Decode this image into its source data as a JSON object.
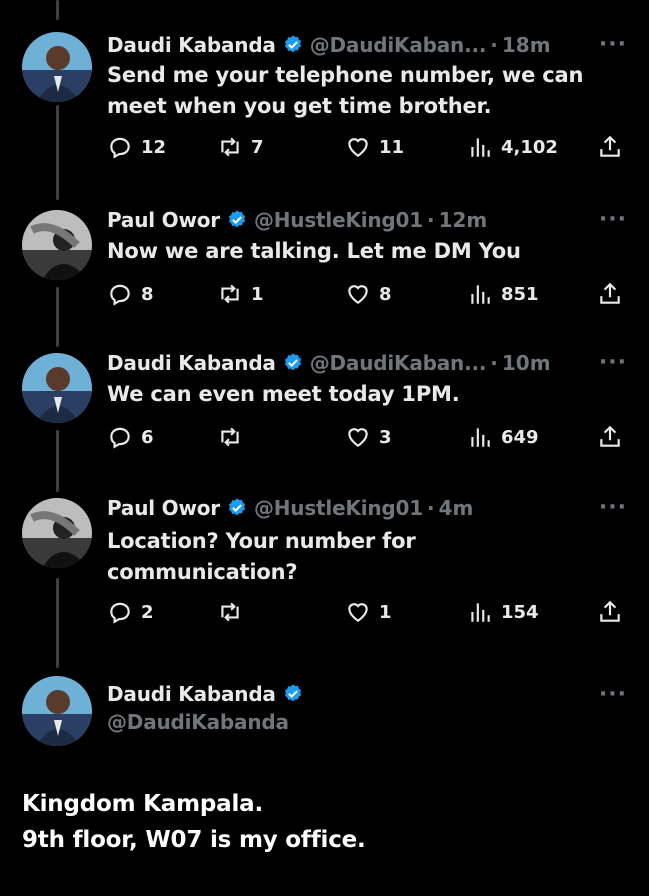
{
  "tweets": [
    {
      "name": "Daudi Kabanda",
      "handle": "@DaudiKaban...",
      "sep": "·",
      "time": "18m",
      "text": "Send me your telephone number, we can meet when you get time brother.",
      "replies": "12",
      "reposts": "7",
      "likes": "11",
      "views": "4,102"
    },
    {
      "name": "Paul Owor",
      "handle": "@HustleKing01",
      "sep": "·",
      "time": "12m",
      "text": "Now we are talking. Let me DM You",
      "replies": "8",
      "reposts": "1",
      "likes": "8",
      "views": "851"
    },
    {
      "name": "Daudi Kabanda",
      "handle": "@DaudiKaban...",
      "sep": "·",
      "time": "10m",
      "text": "We can even meet today 1PM.",
      "replies": "6",
      "reposts": "",
      "likes": "3",
      "views": "649"
    },
    {
      "name": "Paul Owor",
      "handle": "@HustleKing01",
      "sep": "·",
      "time": "4m",
      "text": "Location? Your number for communication?",
      "replies": "2",
      "reposts": "",
      "likes": "1",
      "views": "154"
    }
  ],
  "main_tweet": {
    "name": "Daudi Kabanda",
    "handle": "@DaudiKabanda",
    "line1": "Kingdom Kampala.",
    "line2": "9th floor, W07 is my office."
  },
  "icons": {
    "more": "more-icon",
    "reply": "reply-icon",
    "repost": "repost-icon",
    "like": "heart-icon",
    "views": "views-icon",
    "share": "share-icon",
    "verified": "verified-badge-icon"
  },
  "colors": {
    "background": "#000000",
    "text": "#e7e9ea",
    "muted": "#71767b",
    "verified": "#1d9bf0"
  }
}
